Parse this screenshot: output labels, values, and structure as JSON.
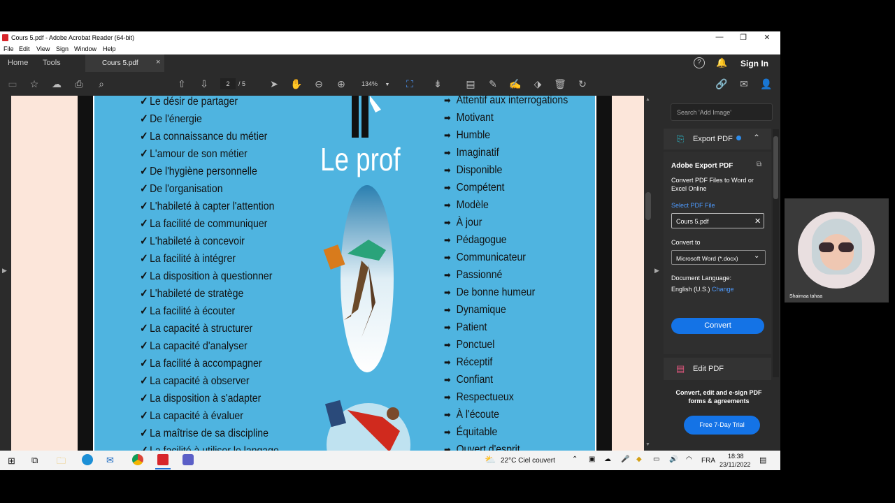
{
  "window": {
    "title": "Cours 5.pdf - Adobe Acrobat Reader (64-bit)",
    "controls": [
      "—",
      "❐",
      "✕"
    ]
  },
  "menu": [
    "File",
    "Edit",
    "View",
    "Sign",
    "Window",
    "Help"
  ],
  "tabs": {
    "home": "Home",
    "tools": "Tools",
    "document": "Cours 5.pdf",
    "close": "×",
    "sign_in": "Sign In"
  },
  "toolbar": {
    "page_current": "2",
    "page_total": "/ 5",
    "zoom": "134%"
  },
  "slide": {
    "title": "Le prof",
    "left_items": [
      "Le désir de partager",
      "De l'énergie",
      "La connaissance du métier",
      "L'amour de son métier",
      "De l'hygiène personnelle",
      "De l'organisation",
      "L'habileté à capter l'attention",
      "La facilité de communiquer",
      "L'habileté à concevoir",
      "La facilité à intégrer",
      "La disposition à questionner",
      "L'habileté de stratège",
      "La facilité à écouter",
      "La capacité à structurer",
      "La capacité d'analyser",
      "La facilité à accompagner",
      "La capacité à observer",
      "La disposition à s'adapter",
      "La capacité à évaluer",
      "La maîtrise de sa discipline",
      "La facilité à utiliser le langage"
    ],
    "right_items": [
      "Attentif aux interrogations",
      "Motivant",
      "Humble",
      "Imaginatif",
      "Disponible",
      "Compétent",
      "Modèle",
      "À jour",
      "Pédagogue",
      "Communicateur",
      "Passionné",
      "De bonne humeur",
      "Dynamique",
      "Patient",
      "Ponctuel",
      "Réceptif",
      "Confiant",
      "Respectueux",
      "À l'écoute",
      "Équitable",
      "Ouvert d'esprit"
    ]
  },
  "right_panel": {
    "search_placeholder": "Search 'Add Image'",
    "export_title": "Export PDF",
    "adobe_export_title": "Adobe Export PDF",
    "adobe_export_desc": "Convert PDF Files to Word or Excel Online",
    "select_file_label": "Select PDF File",
    "selected_file": "Cours 5.pdf",
    "convert_to_label": "Convert to",
    "convert_to_value": "Microsoft Word (*.docx)",
    "doc_language_label": "Document Language:",
    "doc_language_value": "English (U.S.)",
    "change_link": "Change",
    "convert_button": "Convert",
    "edit_pdf": "Edit PDF",
    "promo_text": "Convert, edit and e-sign PDF forms & agreements",
    "trial_button": "Free 7-Day Trial"
  },
  "taskbar": {
    "weather": "22°C  Ciel couvert",
    "lang": "FRA",
    "time": "18:38",
    "date": "23/11/2022"
  },
  "webcam": {
    "name": "Shaimaa tahaa"
  },
  "colors": {
    "accent": "#1473e6",
    "link": "#4e9bff",
    "slide_bg": "#4fb4e0",
    "page_bg": "#fce6da"
  }
}
